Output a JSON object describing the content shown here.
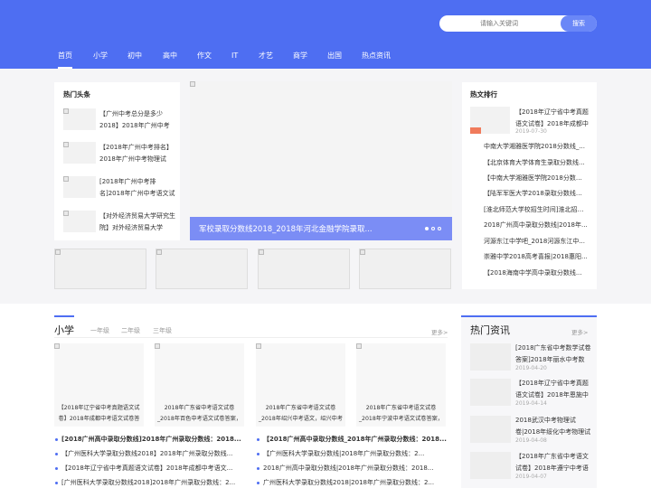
{
  "search": {
    "placeholder": "请输入关键词",
    "button": "搜索"
  },
  "nav": [
    "首页",
    "小学",
    "初中",
    "高中",
    "作文",
    "IT",
    "才艺",
    "商学",
    "出国",
    "热点资讯"
  ],
  "hot_head": {
    "title": "热门头条",
    "items": [
      "【广州中考总分是多少2018】2018年广州中考数",
      "【2018年广州中考排名】2018年广州中考物理试",
      "[2018年广州中考排名]2018年广州中考语文试卷、",
      "【对外经济贸易大学研究生院】对外经济贸易大学"
    ]
  },
  "banner": {
    "caption": "军校录取分数线2018_2018年河北金融学院录取..."
  },
  "rank": {
    "title": "热文排行",
    "top_title": "【2018年辽宁省中考真题语文试卷】2018年成都中",
    "top_date": "2019-07-30",
    "items": [
      "中南大学湘雅医学院2018分数线_...",
      "【北京体育大学体育生录取分数线...",
      "【中南大学湘雅医学院2018分数线...",
      "【陆军军医大学2018录取分数线】...",
      "[淮北师范大学校招生时间]淮北招生...",
      "2018广州高中录取分数线|2018年...",
      "河源东江中学吧_2018河源东江中...",
      "崇雅中学2018高考喜报|2018惠阳...",
      "【2018海南中学高中录取分数线..."
    ]
  },
  "primary": {
    "title": "小学",
    "tabs": [
      "一年级",
      "二年级",
      "三年级"
    ],
    "more": "更多>",
    "cards": [
      "【2018年辽宁省中考真题语文试卷】2018年成都中考语文试卷答",
      "2018年广东省中考语文试卷_2018年百色中考语文试卷答案，百色",
      "2018年广东省中考语文试卷_2018年绍兴中考语文，绍兴中考",
      "2018年广东省中考语文试卷_2018年宁波中考语文试卷答案，宁波"
    ],
    "list": [
      "[2018广州高中录取分数线]2018年广州录取分数线：2018...",
      "【广州医科大学录取分数线2018】2018年广州录取分数线...",
      "【2018年辽宁省中考真题语文试卷】2018年成都中考语文...",
      "[广州医科大学录取分数线2018]2018年广州录取分数线：2...",
      "【2018广州高中录取分数线_2018年广州录取分数线：2018...",
      "【广州医科大学录取分数线|2018年广州录取分数线：2...",
      "2018广州高中录取分数线|2018年广州录取分数线：2018...",
      "广州医科大学录取分数线2018|2018年广州录取分数线：2..."
    ]
  },
  "hot_news": {
    "title": "热门资讯",
    "more": "更多>",
    "items": [
      {
        "t": "[2018广东省中考数学试卷答案]2018年丽水中考数",
        "d": "2019-04-20"
      },
      {
        "t": "【2018年辽宁省中考真题语文试卷】2018年恩施中",
        "d": "2019-04-14"
      },
      {
        "t": "2018武汉中考物理试卷|2018年绥化中考物理试卷",
        "d": "2019-04-08"
      },
      {
        "t": "【2018年广东省中考语文试卷】2018年遵宁中考语",
        "d": "2019-04-07"
      }
    ]
  },
  "colors": {
    "brand": "#4e6ef2",
    "accent": "#f07b5c"
  }
}
